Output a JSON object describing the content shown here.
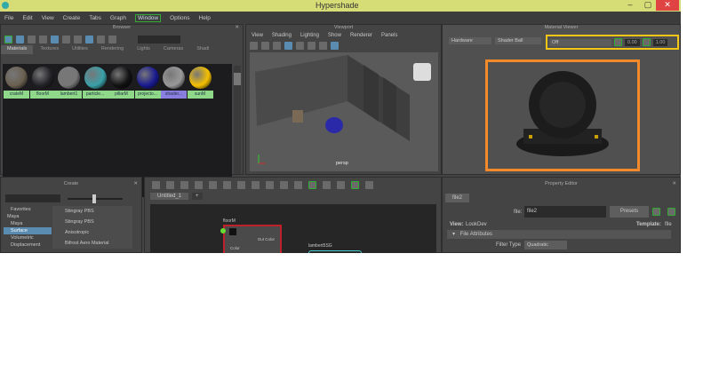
{
  "title": "Hypershade",
  "window_buttons": {
    "minimize": "–",
    "maximize": "▢",
    "close": "✕"
  },
  "menu": [
    "File",
    "Edit",
    "View",
    "Create",
    "Tabs",
    "Graph",
    "Window",
    "Options",
    "Help"
  ],
  "browser": {
    "title": "Browser",
    "tabs": [
      "Materials",
      "Textures",
      "Utilities",
      "Rendering",
      "Lights",
      "Cameras",
      "Shadi"
    ],
    "materials": [
      {
        "name": "crateM",
        "color": "#6a6050"
      },
      {
        "name": "floorM",
        "color": "#222226"
      },
      {
        "name": "lambert1",
        "color": "#777"
      },
      {
        "name": "particle...",
        "color": "#3aa0a8"
      },
      {
        "name": "pillarM",
        "color": "#111"
      },
      {
        "name": "projecto...",
        "color": "#1a1a90"
      },
      {
        "name": "shader...",
        "color": "#999"
      },
      {
        "name": "sunM",
        "color": "#f5c000"
      }
    ]
  },
  "viewport": {
    "title": "Viewport",
    "menu": [
      "View",
      "Shading",
      "Lighting",
      "Show",
      "Renderer",
      "Panels"
    ],
    "camera": "persp"
  },
  "material_viewer": {
    "title": "Material Viewer",
    "renderer": "Hardware",
    "shape": "Shader Ball",
    "env": "Off",
    "exposure": "0.00",
    "gamma": "1.00"
  },
  "create": {
    "title": "Create",
    "tree": [
      "Favorites",
      "Maya",
      "Maya",
      "Surface",
      "Volumetric",
      "Displacement"
    ],
    "list": [
      "Stingray PBS",
      "Stingray PBS",
      "Anisotropic",
      "Bifrost Aero Material"
    ]
  },
  "node_editor": {
    "tab": "Untitled_1",
    "add": "+",
    "node": {
      "name": "floorM",
      "out": "Out Color",
      "attr": "Color"
    },
    "node2": "lambert5SG"
  },
  "property_editor": {
    "title": "Property Editor",
    "node_tab": "file2",
    "file_label": "file:",
    "file_value": "file2",
    "presets": "Presets",
    "view_label": "View:",
    "view_value": "LookDev",
    "template_label": "Template:",
    "template_value": "file",
    "section": "File Attributes",
    "filter_label": "Filter Type",
    "filter_value": "Quadratic"
  },
  "highlight_colors": {
    "yellow": "#f5c518",
    "orange": "#f28a2c"
  }
}
